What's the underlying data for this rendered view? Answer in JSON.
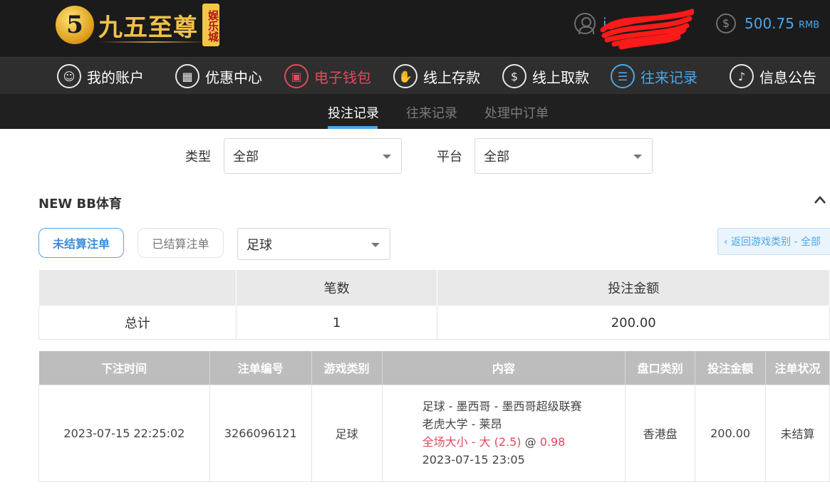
{
  "brand": {
    "badge": "5",
    "name": "九五至尊",
    "stamp": "娱乐城"
  },
  "user": {
    "name": "i"
  },
  "balance": {
    "value": "500.75",
    "currency": "RMB"
  },
  "nav": [
    {
      "label": "我的账户",
      "icon": "user-icon"
    },
    {
      "label": "优惠中心",
      "icon": "gift-icon"
    },
    {
      "label": "电子钱包",
      "icon": "wallet-icon"
    },
    {
      "label": "线上存款",
      "icon": "deposit-icon"
    },
    {
      "label": "线上取款",
      "icon": "withdraw-icon"
    },
    {
      "label": "往来记录",
      "icon": "record-icon"
    },
    {
      "label": "信息公告",
      "icon": "bell-icon"
    }
  ],
  "subtabs": [
    "投注记录",
    "往来记录",
    "处理中订单"
  ],
  "filters": {
    "type_label": "类型",
    "type_value": "全部",
    "platform_label": "平台",
    "platform_value": "全部"
  },
  "section": {
    "title": "NEW BB体育"
  },
  "toggles": {
    "unsettled": "未结算注单",
    "settled": "已结算注单",
    "sport": "足球",
    "back": "‹ 返回游戏类别 - 全部"
  },
  "summary": {
    "headers": [
      "",
      "笔数",
      "投注金额"
    ],
    "row": {
      "label": "总计",
      "count": "1",
      "amount": "200.00"
    }
  },
  "details": {
    "headers": [
      "下注时间",
      "注单编号",
      "游戏类别",
      "内容",
      "盘口类别",
      "投注金额",
      "注单状况"
    ],
    "rows": [
      {
        "time": "2023-07-15 22:25:02",
        "id": "3266096121",
        "category": "足球",
        "content_line1": "足球 - 墨西哥 - 墨西哥超级联赛",
        "content_line2": "老虎大学 - 莱昂",
        "content_bet": "全场大小 - 大 (2.5)",
        "content_at": " @ ",
        "content_odds": "0.98",
        "content_line4": "2023-07-15 23:05",
        "market": "香港盘",
        "amount": "200.00",
        "status": "未结算"
      }
    ]
  },
  "colors": {
    "accent": "#4da6e8",
    "red": "#e04a5f",
    "gold": "#f1c24a"
  }
}
